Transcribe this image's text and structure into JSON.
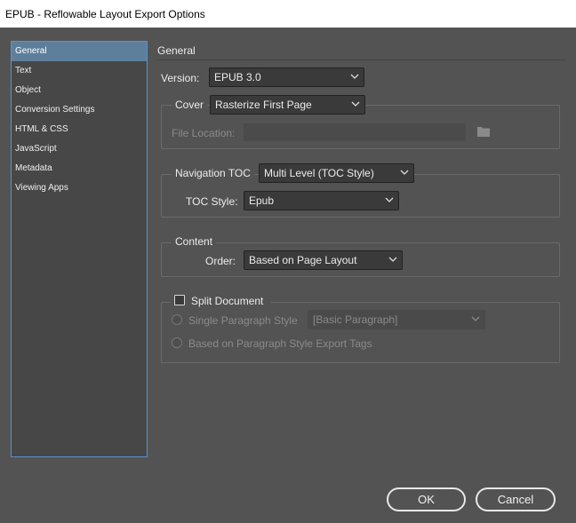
{
  "window": {
    "title": "EPUB - Reflowable Layout Export Options"
  },
  "sidebar": {
    "items": [
      {
        "label": "General",
        "selected": true
      },
      {
        "label": "Text"
      },
      {
        "label": "Object"
      },
      {
        "label": "Conversion Settings"
      },
      {
        "label": "HTML & CSS"
      },
      {
        "label": "JavaScript"
      },
      {
        "label": "Metadata"
      },
      {
        "label": "Viewing Apps"
      }
    ]
  },
  "general": {
    "heading": "General",
    "version": {
      "label": "Version:",
      "value": "EPUB 3.0"
    },
    "cover": {
      "label": "Cover",
      "value": "Rasterize First Page",
      "file_location_label": "File Location:",
      "file_location_value": ""
    },
    "navigation": {
      "label": "Navigation TOC",
      "value": "Multi Level (TOC Style)",
      "toc_style_label": "TOC Style:",
      "toc_style_value": "Epub"
    },
    "content": {
      "legend": "Content",
      "order_label": "Order:",
      "order_value": "Based on Page Layout"
    },
    "split": {
      "label": "Split Document",
      "checked": false,
      "single_paragraph_label": "Single Paragraph Style",
      "single_paragraph_value": "[Basic Paragraph]",
      "export_tags_label": "Based on Paragraph Style Export Tags"
    }
  },
  "buttons": {
    "ok": "OK",
    "cancel": "Cancel"
  },
  "icons": {
    "dropdown": "chevron-down-icon",
    "folder": "folder-icon"
  },
  "colors": {
    "background": "#535353",
    "selection": "#5e7f9c",
    "sidebar_border": "#5a92d0"
  }
}
